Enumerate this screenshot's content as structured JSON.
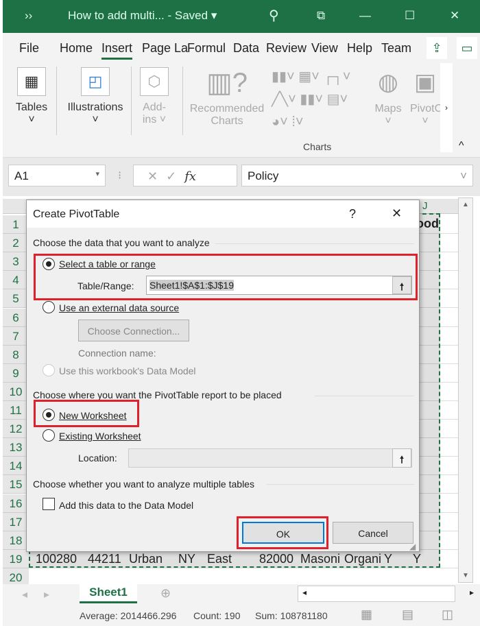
{
  "titlebar": {
    "more": "››",
    "title": "How to add multi...  -  Saved ▾",
    "search_icon": "search-icon",
    "restore": "⧉",
    "minimize": "—",
    "maximize": "☐",
    "close": "✕"
  },
  "tabs": [
    "File",
    "Home",
    "Insert",
    "Page La",
    "Formul",
    "Data",
    "Review",
    "View",
    "Help",
    "Team"
  ],
  "ribbon": {
    "tables": "Tables",
    "illustrations": "Illustrations",
    "addins1": "Add-",
    "addins2": "ins ˅",
    "rec1": "Recommended",
    "rec2": "Charts",
    "maps": "Maps",
    "pivot": "PivotC",
    "group_charts": "Charts"
  },
  "formula_bar": {
    "name_box": "A1",
    "fx": "fx",
    "value": "Policy"
  },
  "columns": {
    "j": "J"
  },
  "row_numbers": [
    "1",
    "2",
    "3",
    "4",
    "5",
    "6",
    "7",
    "8",
    "9",
    "10",
    "11",
    "12",
    "13",
    "14",
    "15",
    "16",
    "17",
    "18",
    "19",
    "20"
  ],
  "row1_j": "lood",
  "row19": [
    "100280",
    "44211",
    "Urban",
    "NY",
    "East",
    "82000",
    "Masoni",
    "Organi",
    "Y",
    "Y"
  ],
  "dialog": {
    "title": "Create PivotTable",
    "help": "?",
    "close": "✕",
    "section1": "Choose the data that you want to analyze",
    "opt_select": "Select a table or range",
    "table_range_label": "Table/Range:",
    "table_range_value": "Sheet1!$A$1:$J$19",
    "opt_external": "Use an external data source",
    "choose_connection": "Choose Connection...",
    "connection_name": "Connection name:",
    "opt_datamodel": "Use this workbook's Data Model",
    "section2": "Choose where you want the PivotTable report to be placed",
    "opt_new": "New Worksheet",
    "opt_existing": "Existing Worksheet",
    "location_label": "Location:",
    "location_value": "",
    "section3": "Choose whether you want to analyze multiple tables",
    "add_datamodel": "Add this data to the Data Model",
    "ok": "OK",
    "cancel": "Cancel"
  },
  "sheet_tab": "Sheet1",
  "status": {
    "average": "Average: 2014466.296",
    "count": "Count: 190",
    "sum": "Sum: 108781180"
  }
}
